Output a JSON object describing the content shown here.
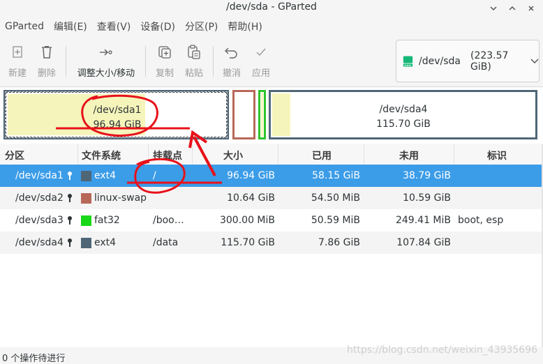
{
  "window": {
    "title": "/dev/sda - GParted",
    "controls": [
      "minimize",
      "maximize",
      "close"
    ]
  },
  "menubar": {
    "items": [
      "GParted",
      "编辑(E)",
      "查看(V)",
      "设备(D)",
      "分区(P)",
      "帮助(H)"
    ]
  },
  "toolbar": {
    "buttons": [
      {
        "label": "新建",
        "icon": "new-icon",
        "enabled": false
      },
      {
        "label": "删除",
        "icon": "delete-icon",
        "enabled": false
      },
      {
        "label": "调整大小/移动",
        "icon": "resize-move-icon",
        "enabled": true
      },
      {
        "label": "复制",
        "icon": "copy-icon",
        "enabled": false
      },
      {
        "label": "粘贴",
        "icon": "paste-icon",
        "enabled": false
      },
      {
        "label": "撤消",
        "icon": "undo-icon",
        "enabled": false
      },
      {
        "label": "应用",
        "icon": "apply-icon",
        "enabled": false
      }
    ],
    "device": {
      "name": "/dev/sda",
      "size": "(223.57 GiB)",
      "icon": "disk-icon"
    }
  },
  "graph": {
    "partitions": [
      {
        "name": "/dev/sda1",
        "size": "96.94 GiB"
      },
      {
        "name": "/dev/sda2",
        "size": ""
      },
      {
        "name": "/dev/sda3",
        "size": ""
      },
      {
        "name": "/dev/sda4",
        "size": "115.70 GiB"
      }
    ]
  },
  "table": {
    "headers": [
      "分区",
      "文件系统",
      "挂载点",
      "大小",
      "已用",
      "未用",
      "标识"
    ],
    "rows": [
      {
        "partition": "/dev/sda1",
        "fs": "ext4",
        "fs_color": "#4f6677",
        "mount": "/",
        "size": "96.94 GiB",
        "used": "58.15 GiB",
        "unused": "38.79 GiB",
        "flags": "",
        "selected": true
      },
      {
        "partition": "/dev/sda2",
        "fs": "linux-swap",
        "fs_color": "#b86859",
        "mount": "",
        "size": "10.64 GiB",
        "used": "54.50 MiB",
        "unused": "10.59 GiB",
        "flags": "",
        "selected": false
      },
      {
        "partition": "/dev/sda3",
        "fs": "fat32",
        "fs_color": "#18d818",
        "mount": "/boo…",
        "size": "300.00 MiB",
        "used": "50.59 MiB",
        "unused": "249.41 MiB",
        "flags": "boot, esp",
        "selected": false
      },
      {
        "partition": "/dev/sda4",
        "fs": "ext4",
        "fs_color": "#4f6677",
        "mount": "/data",
        "size": "115.70 GiB",
        "used": "7.86 GiB",
        "unused": "107.84 GiB",
        "flags": "",
        "selected": false
      }
    ]
  },
  "statusbar": {
    "text": "0 个操作待进行"
  },
  "watermark": "https://blog.csdn.net/weixin_43935696",
  "colors": {
    "selection": "#3b9ce8",
    "annotation": "#e8111a",
    "ext4": "#4f6677",
    "swap": "#b86859",
    "fat32": "#18d818",
    "used_fill": "#f5f5bb"
  }
}
